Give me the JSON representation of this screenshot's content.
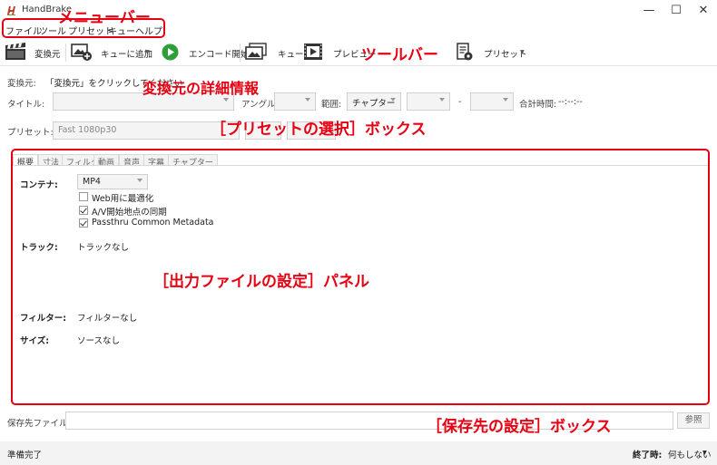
{
  "window": {
    "title": "HandBrake",
    "minimize_glyph": "—",
    "maximize_glyph": "☐",
    "close_glyph": "✕"
  },
  "menu": {
    "items": [
      "ファイル",
      "ツール",
      "プリセット",
      "キュー",
      "ヘルプ"
    ]
  },
  "toolbar": {
    "source": "変換元",
    "add_to_queue": "キューに追加",
    "encode": "エンコード開始",
    "queue": "キュー",
    "preview": "プレビュー",
    "presets": "プリセット",
    "dropdown_glyph": "▾"
  },
  "source": {
    "label": "変換元:",
    "hint": "「変換元」をクリックしてください"
  },
  "title_row": {
    "title_label": "タイトル:",
    "angle_label": "アングル:",
    "range_label": "範囲:",
    "range_value": "チャプター",
    "dash": "-",
    "duration_label": "合計時間:",
    "duration_value": "--:--:--"
  },
  "preset_row": {
    "label": "プリセット:",
    "value": "Fast 1080p30"
  },
  "tabs": [
    "概要",
    "寸法",
    "フィルタ",
    "動画",
    "音声",
    "字幕",
    "チャプター"
  ],
  "summary": {
    "container_label": "コンテナ:",
    "container_value": "MP4",
    "web_optimize": "Web用に最適化",
    "av_sync": "A/V開始地点の同期",
    "passthru": "Passthru Common Metadata",
    "tracks_label": "トラック:",
    "tracks_value": "トラックなし",
    "filters_label": "フィルター:",
    "filters_value": "フィルターなし",
    "size_label": "サイズ:",
    "size_value": "ソースなし"
  },
  "destination": {
    "label": "保存先ファイル:",
    "browse": "参照"
  },
  "status": {
    "text": "準備完了",
    "when_done_label": "終了時:",
    "when_done_value": "何もしない"
  },
  "annotations": {
    "menubar": "メニューバー",
    "toolbar": "ツールバー",
    "source_info": "変換元の詳細情報",
    "preset_box": "［プリセットの選択］ボックス",
    "output_panel": "［出力ファイルの設定］パネル",
    "destination_box": "［保存先の設定］ボックス"
  },
  "colors": {
    "annotation_red": "#e60012",
    "encode_green": "#2e9e3a"
  }
}
